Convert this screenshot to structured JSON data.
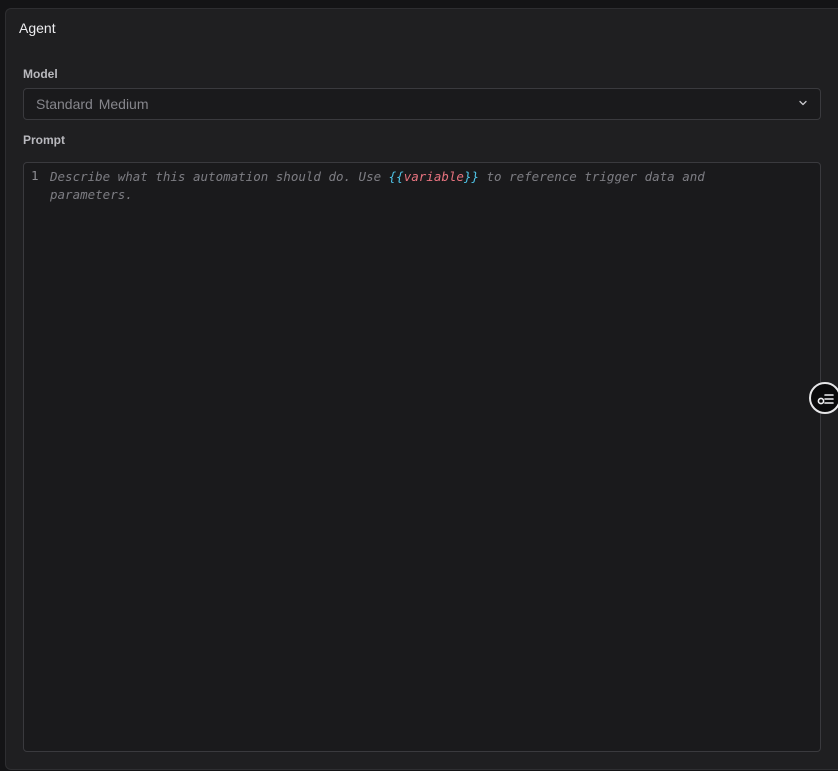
{
  "panel": {
    "title": "Agent"
  },
  "model": {
    "label": "Model",
    "selected_value": "Standard Medium",
    "chevron_icon": "chevron-down-icon"
  },
  "prompt": {
    "label": "Prompt",
    "line_number": "1",
    "placeholder_before": "Describe what this automation should do. Use ",
    "placeholder_open_brace": "{{",
    "placeholder_variable": "variable",
    "placeholder_close_brace": "}}",
    "placeholder_after": " to reference trigger data and parameters."
  },
  "floating_button": {
    "icon": "settings-list-icon"
  },
  "colors": {
    "background": "#1f1f21",
    "brace": "#4fc3e6",
    "variable": "#e8737f"
  }
}
